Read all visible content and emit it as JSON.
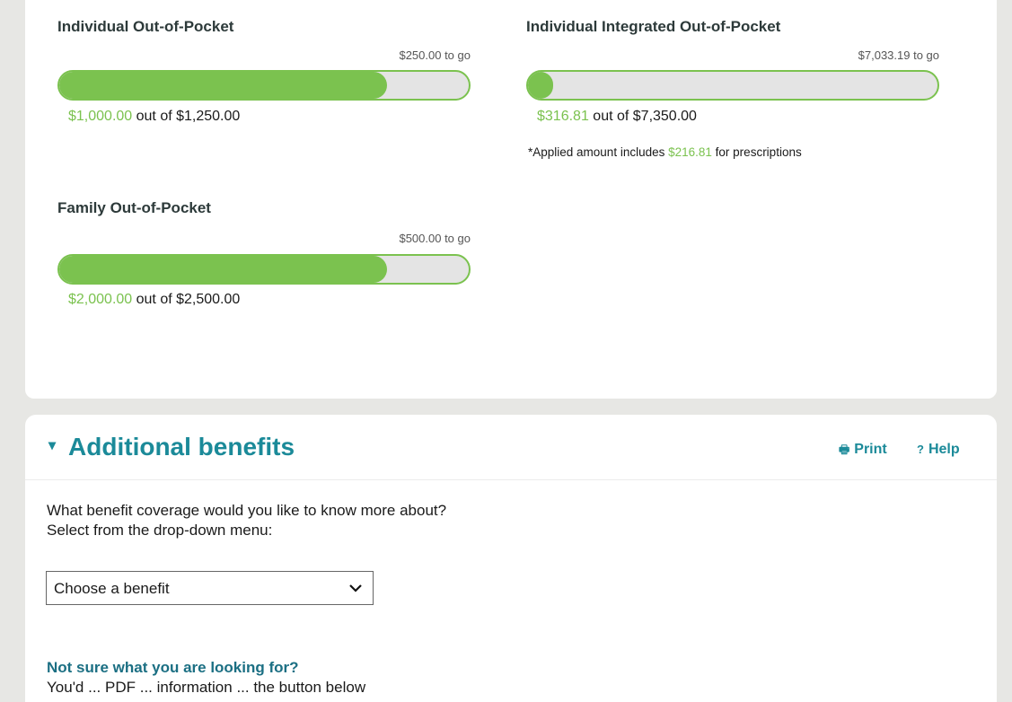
{
  "meters": {
    "individual_oop": {
      "title": "Individual Out-of-Pocket",
      "to_go": "$250.00 to go",
      "applied": "$1,000.00",
      "out_of_text": " out of $1,250.00",
      "progress_fraction": 0.8
    },
    "individual_integrated_oop": {
      "title": "Individual Integrated Out-of-Pocket",
      "to_go": "$7,033.19 to go",
      "applied": "$316.81",
      "out_of_text": " out of $7,350.00",
      "progress_fraction": 0.043,
      "note_prefix": "*Applied amount includes ",
      "note_amount": "$216.81",
      "note_suffix": " for prescriptions"
    },
    "family_oop": {
      "title": "Family Out-of-Pocket",
      "to_go": "$500.00 to go",
      "applied": "$2,000.00",
      "out_of_text": " out of $2,500.00",
      "progress_fraction": 0.8
    }
  },
  "additional_benefits": {
    "collapse_icon": "▾",
    "title": "Additional benefits",
    "print_icon": "🖶",
    "print_label": "Print",
    "help_icon": "?",
    "help_label": "Help",
    "question_line1": "What benefit coverage would you like to know more about?",
    "question_line2": "Select from the drop-down menu:",
    "select_value": "Choose a benefit",
    "not_sure_heading": "Not sure what you are looking for?",
    "cut_off_text": "You'd ... PDF ... information ... the button below"
  },
  "colors": {
    "progress_green": "#7bc24f",
    "heading_teal": "#1b8a99",
    "page_background": "#e7e7e4"
  }
}
